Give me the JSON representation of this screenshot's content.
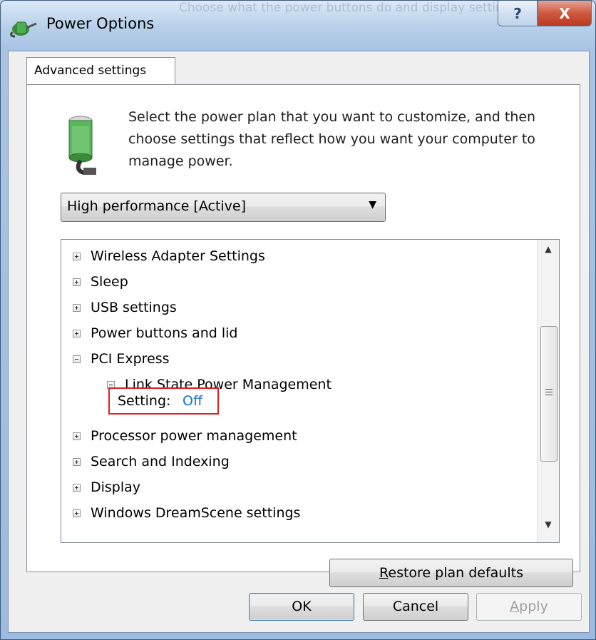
{
  "window": {
    "title": "Power Options",
    "background_title_ghost": "Choose what the power buttons do and display settings",
    "help_label": "?",
    "close_label": "X"
  },
  "tab": {
    "label": "Advanced settings"
  },
  "intro": {
    "text": "Select the power plan that you want to customize, and then choose settings that reflect how you want your computer to manage power."
  },
  "plan_select": {
    "selected": "High performance [Active]"
  },
  "tree": {
    "items": [
      {
        "label": "Wireless Adapter Settings",
        "expanded": false
      },
      {
        "label": "Sleep",
        "expanded": false
      },
      {
        "label": "USB settings",
        "expanded": false
      },
      {
        "label": "Power buttons and lid",
        "expanded": false
      },
      {
        "label": "PCI Express",
        "expanded": true
      },
      {
        "label": "Link State Power Management",
        "expanded": true
      },
      {
        "label": "Processor power management",
        "expanded": false
      },
      {
        "label": "Search and Indexing",
        "expanded": false
      },
      {
        "label": "Display",
        "expanded": false
      },
      {
        "label": "Windows DreamScene settings",
        "expanded": false
      }
    ],
    "setting": {
      "label": "Setting:",
      "value": "Off"
    }
  },
  "buttons": {
    "restore_prefix": "R",
    "restore_rest": "estore plan defaults",
    "ok": "OK",
    "cancel": "Cancel",
    "apply_prefix": "A",
    "apply_rest": "pply"
  },
  "colors": {
    "highlight_border": "#e02020",
    "link_value": "#1c6fd3"
  }
}
